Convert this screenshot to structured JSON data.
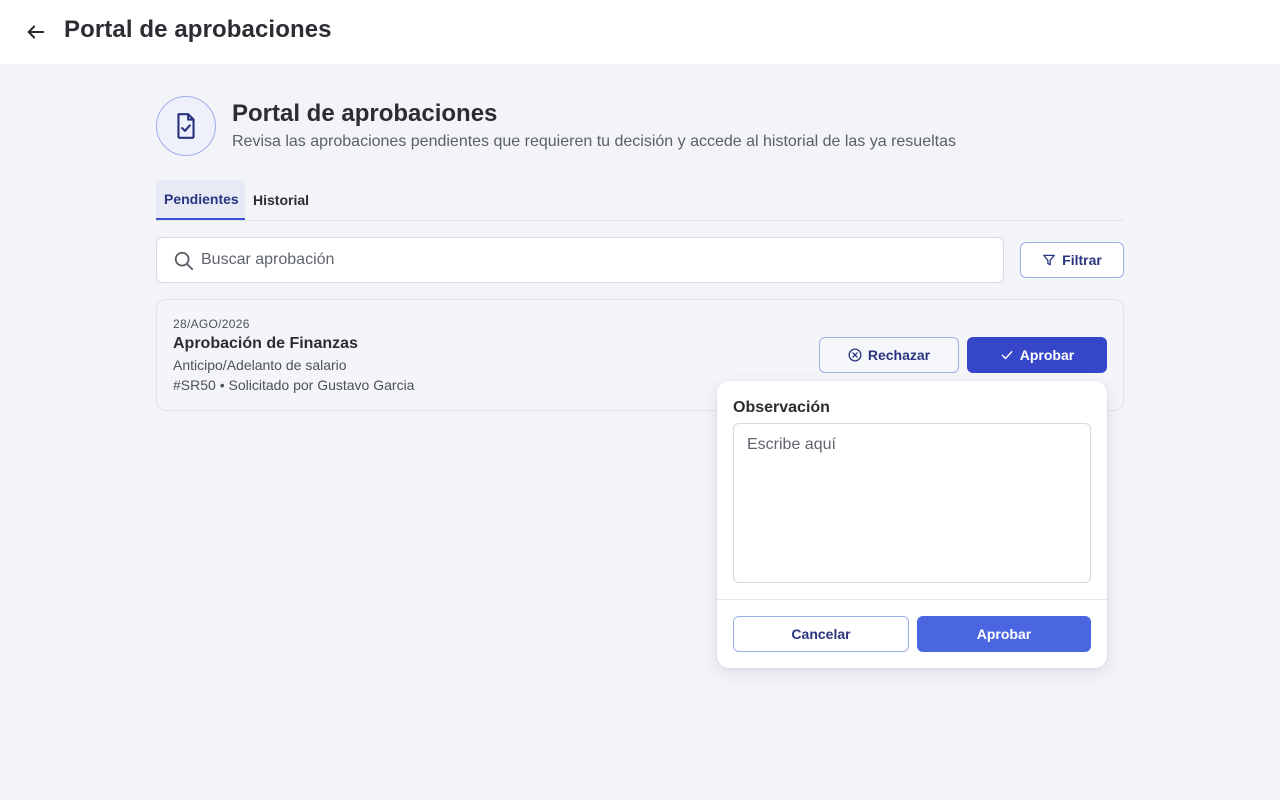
{
  "header": {
    "back_icon": "arrow-left-icon",
    "title": "Portal de aprobaciones"
  },
  "page": {
    "icon": "document-check-icon",
    "title": "Portal de aprobaciones",
    "subtitle": "Revisa las aprobaciones pendientes que requieren tu decisión y accede al historial de las ya resueltas"
  },
  "tabs": [
    {
      "label": "Pendientes",
      "active": true
    },
    {
      "label": "Historial",
      "active": false
    }
  ],
  "search": {
    "icon": "search-icon",
    "placeholder": "Buscar aprobación",
    "value": ""
  },
  "filter": {
    "icon": "filter-icon",
    "label": "Filtrar"
  },
  "approvals": [
    {
      "date": "28/AGO/2026",
      "title": "Aprobación de Finanzas",
      "subtitle": "Anticipo/Adelanto de salario",
      "meta": "#SR50 • Solicitado por Gustavo Garcia",
      "reject_label": "Rechazar",
      "reject_icon": "circle-x-icon",
      "approve_label": "Aprobar",
      "approve_icon": "check-icon"
    }
  ],
  "popover": {
    "label": "Observación",
    "placeholder": "Escribe aquí",
    "value": "",
    "cancel_label": "Cancelar",
    "confirm_label": "Aprobar"
  },
  "colors": {
    "primary": "#3646c9",
    "primary_light": "#4a66e0",
    "accent_border": "#9fb0e8",
    "text_dark": "#2b2d33",
    "background": "#f3f4f7"
  }
}
